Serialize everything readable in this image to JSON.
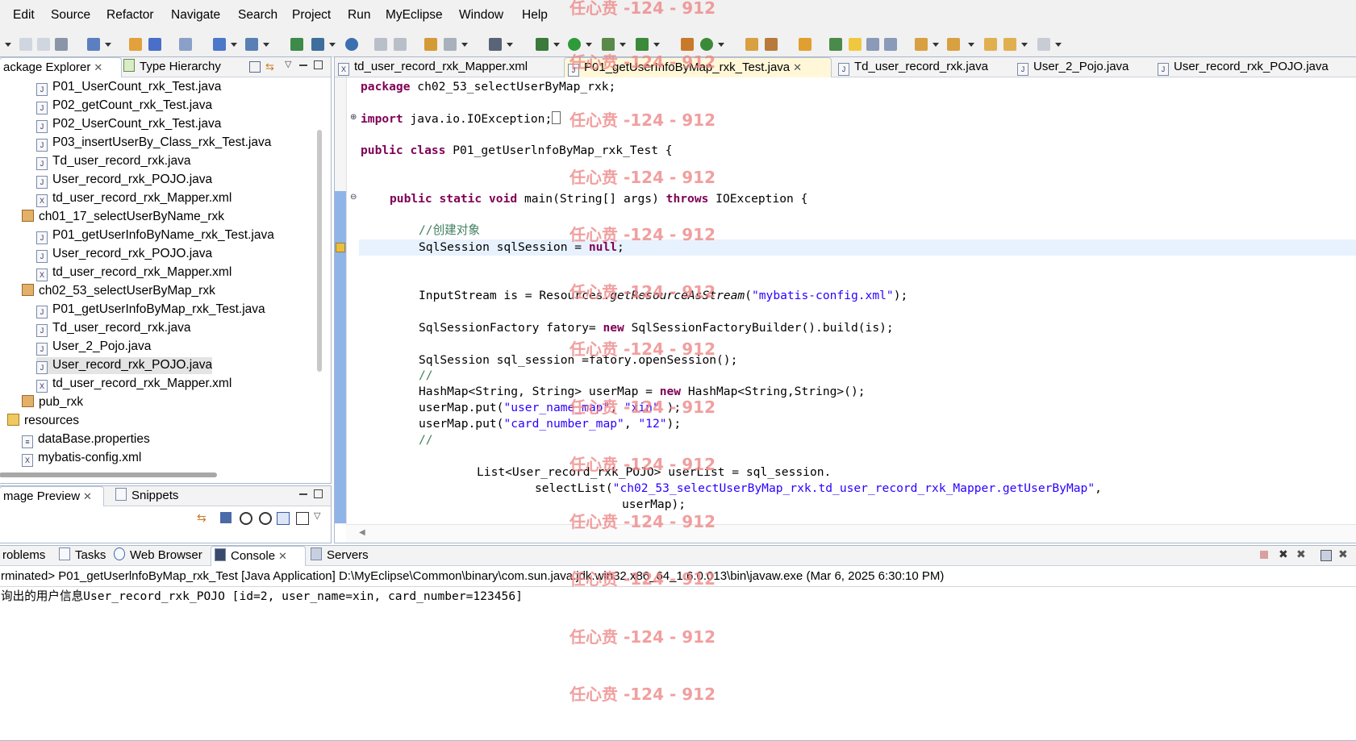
{
  "menu": [
    "Edit",
    "Source",
    "Refactor",
    "Navigate",
    "Search",
    "Project",
    "Run",
    "MyEclipse",
    "Window",
    "Help"
  ],
  "left_panel": {
    "tabs": [
      "ackage Explorer",
      "Type Hierarchy"
    ],
    "tree": [
      {
        "label": "P01_UserCount_rxk_Test.java",
        "kind": "java"
      },
      {
        "label": "P02_getCount_rxk_Test.java",
        "kind": "java"
      },
      {
        "label": "P02_UserCount_rxk_Test.java",
        "kind": "java"
      },
      {
        "label": "P03_insertUserBy_Class_rxk_Test.java",
        "kind": "java"
      },
      {
        "label": "Td_user_record_rxk.java",
        "kind": "java"
      },
      {
        "label": "User_record_rxk_POJO.java",
        "kind": "java"
      },
      {
        "label": "td_user_record_rxk_Mapper.xml",
        "kind": "xml"
      },
      {
        "label": "ch01_17_selectUserByName_rxk",
        "kind": "package"
      },
      {
        "label": "P01_getUserInfoByName_rxk_Test.java",
        "kind": "java"
      },
      {
        "label": "User_record_rxk_POJO.java",
        "kind": "java"
      },
      {
        "label": "td_user_record_rxk_Mapper.xml",
        "kind": "xml"
      },
      {
        "label": "ch02_53_selectUserByMap_rxk",
        "kind": "package"
      },
      {
        "label": "P01_getUserInfoByMap_rxk_Test.java",
        "kind": "java"
      },
      {
        "label": "Td_user_record_rxk.java",
        "kind": "java"
      },
      {
        "label": "User_2_Pojo.java",
        "kind": "java"
      },
      {
        "label": "User_record_rxk_POJO.java",
        "kind": "java",
        "selected": true
      },
      {
        "label": "td_user_record_rxk_Mapper.xml",
        "kind": "xml"
      },
      {
        "label": "pub_rxk",
        "kind": "package"
      },
      {
        "label": "resources",
        "kind": "folder"
      },
      {
        "label": "dataBase.properties",
        "kind": "props"
      },
      {
        "label": "mybatis-config.xml",
        "kind": "xml"
      }
    ]
  },
  "preview_panel": {
    "tabs": [
      "mage Preview",
      "Snippets"
    ]
  },
  "editor": {
    "tabs": [
      "td_user_record_rxk_Mapper.xml",
      "P01_getUserInfoByMap_rxk_Test.java",
      "Td_user_record_rxk.java",
      "User_2_Pojo.java",
      "User_record_rxk_POJO.java"
    ],
    "lines": {
      "l1a": "package",
      "l1b": " ch02_53_selectUserByMap_rxk;",
      "l2a": "import",
      "l2b": " java.io.IOException;",
      "l3a": "public class",
      "l3b": " P01_getUserlnfoByMap_rxk_Test {",
      "l4a": "public static void",
      "l4b": " main(String[] args) ",
      "l4c": "throws",
      "l4d": " IOException {",
      "l5": "//创建对象",
      "l6a": "SqlSession sqlSession = ",
      "l6b": "null",
      "l6c": ";",
      "l7a": "InputStream is = Resources.",
      "l7b": "getResourceAsStream",
      "l7c": "(",
      "l7d": "\"mybatis-config.xml\"",
      "l7e": ");",
      "l8a": "SqlSessionFactory fatory= ",
      "l8b": "new",
      "l8c": " SqlSessionFactoryBuilder().build(is);",
      "l9": "SqlSession sql_session =fatory.openSession();",
      "l10": "//",
      "l11a": "HashMap<String, String> userMap = ",
      "l11b": "new",
      "l11c": " HashMap<String,String>();",
      "l12a": "userMap.put(",
      "l12b": "\"user_name_map\"",
      "l12c": ", ",
      "l12d": "\"xin\"",
      "l12e": " );",
      "l13a": "userMap.put(",
      "l13b": "\"card_number_map\"",
      "l13c": ", ",
      "l13d": "\"12\"",
      "l13e": ");",
      "l14": "//",
      "l15": "List<User_record_rxk_POJO> userList = sql_session.",
      "l16a": "selectList(",
      "l16b": "\"ch02_53_selectUserByMap_rxk.td_user_record_rxk_Mapper.getUserByMap\"",
      "l16c": ",",
      "l17": "userMap);"
    }
  },
  "console": {
    "tabs": [
      "roblems",
      "Tasks",
      "Web Browser",
      "Console",
      "Servers"
    ],
    "header": "rminated> P01_getUserlnfoByMap_rxk_Test [Java Application] D:\\MyEclipse\\Common\\binary\\com.sun.java.jdk.win32.x86_64_1.6.0.013\\bin\\javaw.exe (Mar 6, 2025 6:30:10 PM)",
    "output": "询出的用户信息User_record_rxk_POJO [id=2, user_name=xin, card_number=123456]"
  },
  "watermark": "任心贲 -124 - 912"
}
